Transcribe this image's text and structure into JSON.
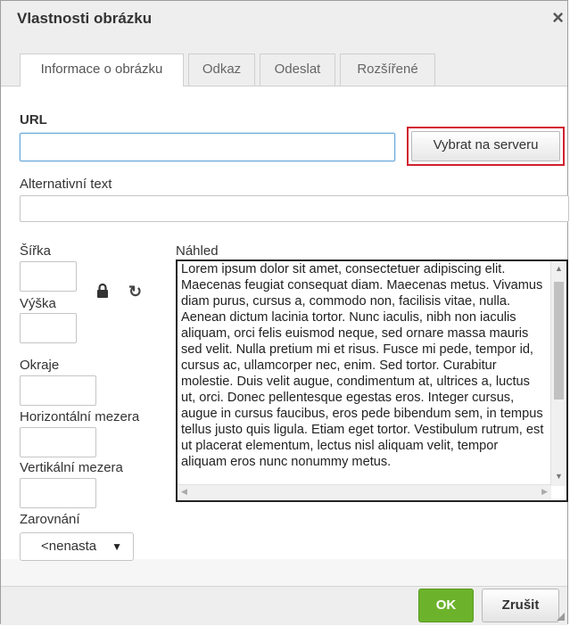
{
  "dialog": {
    "title": "Vlastnosti obrázku",
    "close_icon": "×"
  },
  "tabs": [
    {
      "label": "Informace o obrázku",
      "active": true
    },
    {
      "label": "Odkaz",
      "active": false
    },
    {
      "label": "Odeslat",
      "active": false
    },
    {
      "label": "Rozšířené",
      "active": false
    }
  ],
  "form": {
    "url_label": "URL",
    "url_value": "",
    "browse_server_label": "Vybrat na serveru",
    "alt_label": "Alternativní text",
    "alt_value": "",
    "width_label": "Šířka",
    "width_value": "",
    "height_label": "Výška",
    "height_value": "",
    "border_label": "Okraje",
    "border_value": "",
    "hspace_label": "Horizontální mezera",
    "hspace_value": "",
    "vspace_label": "Vertikální mezera",
    "vspace_value": "",
    "align_label": "Zarovnání",
    "align_value": "<nenasta",
    "align_arrow": "▼",
    "lock_icon": "lock-icon",
    "reset_icon": "↻"
  },
  "preview": {
    "label": "Náhled",
    "text": "Lorem ipsum dolor sit amet, consectetuer adipiscing elit. Maecenas feugiat consequat diam. Maecenas metus. Vivamus diam purus, cursus a, commodo non, facilisis vitae, nulla. Aenean dictum lacinia tortor. Nunc iaculis, nibh non iaculis aliquam, orci felis euismod neque, sed ornare massa mauris sed velit. Nulla pretium mi et risus. Fusce mi pede, tempor id, cursus ac, ullamcorper nec, enim. Sed tortor. Curabitur molestie. Duis velit augue, condimentum at, ultrices a, luctus ut, orci. Donec pellentesque egestas eros. Integer cursus, augue in cursus faucibus, eros pede bibendum sem, in tempus tellus justo quis ligula. Etiam eget tortor. Vestibulum rutrum, est ut placerat elementum, lectus nisl aliquam velit, tempor aliquam eros nunc nonummy metus.",
    "scroll_up": "▲",
    "scroll_down": "▼",
    "scroll_left": "◀",
    "scroll_right": "▶"
  },
  "footer": {
    "ok_label": "OK",
    "cancel_label": "Zrušit"
  },
  "colors": {
    "ok_green": "#6cb32b",
    "highlight_red": "#d0202f",
    "focus_blue": "#67a7d8"
  }
}
